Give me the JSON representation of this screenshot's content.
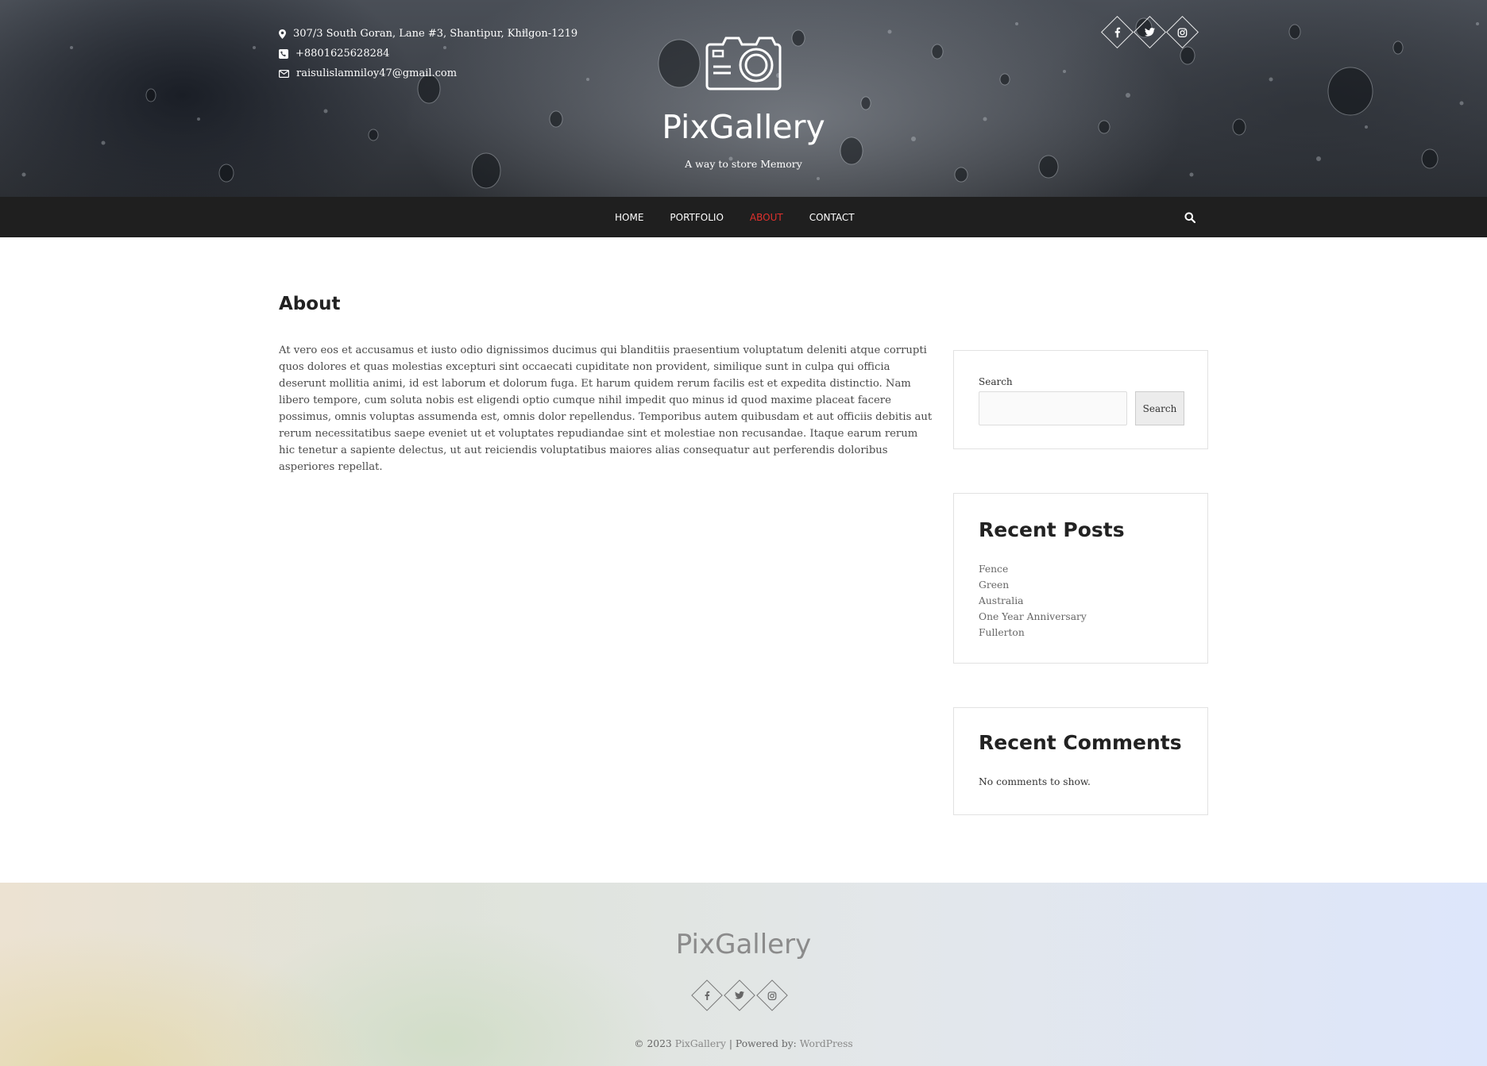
{
  "header": {
    "address": "307/3 South Goran, Lane #3, Shantipur, Khilgon-1219",
    "phone": "+8801625628284",
    "email": "raisulislamniloy47@gmail.com",
    "site_title": "PixGallery",
    "tagline": "A way to store Memory",
    "social": [
      "facebook-icon",
      "twitter-icon",
      "instagram-icon"
    ]
  },
  "nav": {
    "items": [
      {
        "label": "HOME"
      },
      {
        "label": "PORTFOLIO"
      },
      {
        "label": "ABOUT",
        "active": true
      },
      {
        "label": "CONTACT"
      }
    ],
    "active_color": "#e0312d"
  },
  "main": {
    "title": "About",
    "body": "At vero eos et accusamus et iusto odio dignissimos ducimus qui blanditiis praesentium voluptatum deleniti atque corrupti quos dolores et quas molestias excepturi sint occaecati cupiditate non provident, similique sunt in culpa qui officia deserunt mollitia animi, id est laborum et dolorum fuga. Et harum quidem rerum facilis est et expedita distinctio. Nam libero tempore, cum soluta nobis est eligendi optio cumque nihil impedit quo minus id quod maxime placeat facere possimus, omnis voluptas assumenda est, omnis dolor repellendus. Temporibus autem quibusdam et aut officiis debitis aut rerum necessitatibus saepe eveniet ut et voluptates repudiandae sint et molestiae non recusandae. Itaque earum rerum hic tenetur a sapiente delectus, ut aut reiciendis voluptatibus maiores alias consequatur aut perferendis doloribus asperiores repellat."
  },
  "sidebar": {
    "search": {
      "label": "Search",
      "button": "Search",
      "value": ""
    },
    "recent_posts": {
      "heading": "Recent Posts",
      "items": [
        "Fence",
        "Green",
        "Australia",
        "One Year Anniversary",
        "Fullerton"
      ]
    },
    "recent_comments": {
      "heading": "Recent Comments",
      "empty": "No comments to show."
    }
  },
  "footer": {
    "title": "PixGallery",
    "copyright_prefix": "© 2023",
    "copyright_site": "PixGallery",
    "powered_label": "| Powered by:",
    "powered_link": "WordPress"
  }
}
